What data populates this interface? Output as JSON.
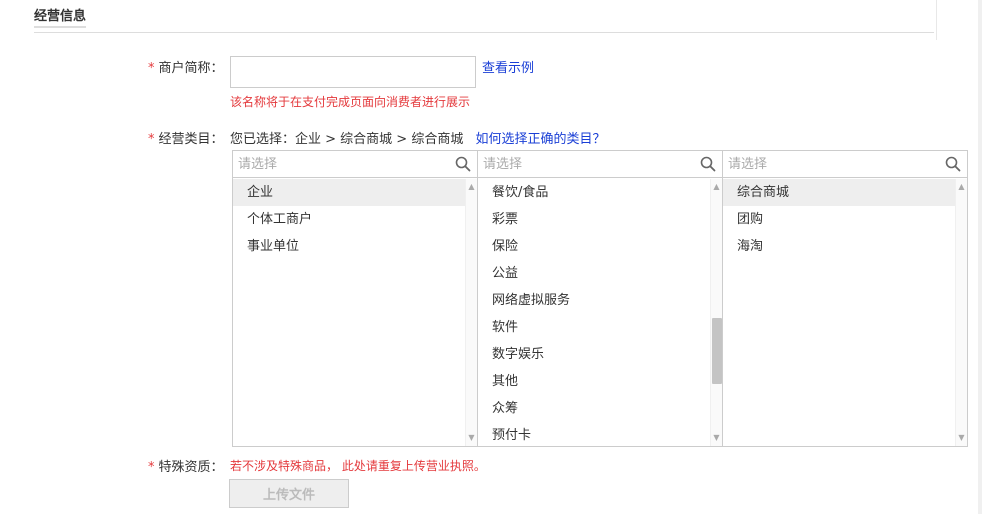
{
  "section": {
    "title": "经营信息"
  },
  "merchant_name": {
    "required_mark": "*",
    "label": "商户简称：",
    "value": "",
    "placeholder": "",
    "example_link": "查看示例",
    "hint": "该名称将于在支付完成页面向消费者进行展示"
  },
  "category": {
    "required_mark": "*",
    "label": "经营类目：",
    "selected_text": "您已选择：企业 > 综合商城 > 综合商城",
    "help_link": "如何选择正确的类目？",
    "columns": [
      {
        "search_placeholder": "请选择",
        "items": [
          {
            "label": "企业",
            "active": true
          },
          {
            "label": "个体工商户",
            "active": false
          },
          {
            "label": "事业单位",
            "active": false
          }
        ],
        "scroll_position": 0
      },
      {
        "search_placeholder": "请选择",
        "items": [
          {
            "label": "餐饮/食品",
            "active": false
          },
          {
            "label": "彩票",
            "active": false
          },
          {
            "label": "保险",
            "active": false
          },
          {
            "label": "公益",
            "active": false
          },
          {
            "label": "网络虚拟服务",
            "active": false
          },
          {
            "label": "软件",
            "active": false
          },
          {
            "label": "数字娱乐",
            "active": false
          },
          {
            "label": "其他",
            "active": false
          },
          {
            "label": "众筹",
            "active": false
          },
          {
            "label": "预付卡",
            "active": false
          }
        ],
        "scroll_position": 0.72
      },
      {
        "search_placeholder": "请选择",
        "items": [
          {
            "label": "综合商城",
            "active": true
          },
          {
            "label": "团购",
            "active": false
          },
          {
            "label": "海淘",
            "active": false
          }
        ],
        "scroll_position": 0
      }
    ]
  },
  "special_qualification": {
    "required_mark": "*",
    "label": "特殊资质：",
    "note": "若不涉及特殊商品， 此处请重复上传营业执照。",
    "upload_button": "上传文件"
  },
  "colors": {
    "required": "#e4393c",
    "link": "#1a3fd6",
    "active_row": "#eeeeee"
  }
}
